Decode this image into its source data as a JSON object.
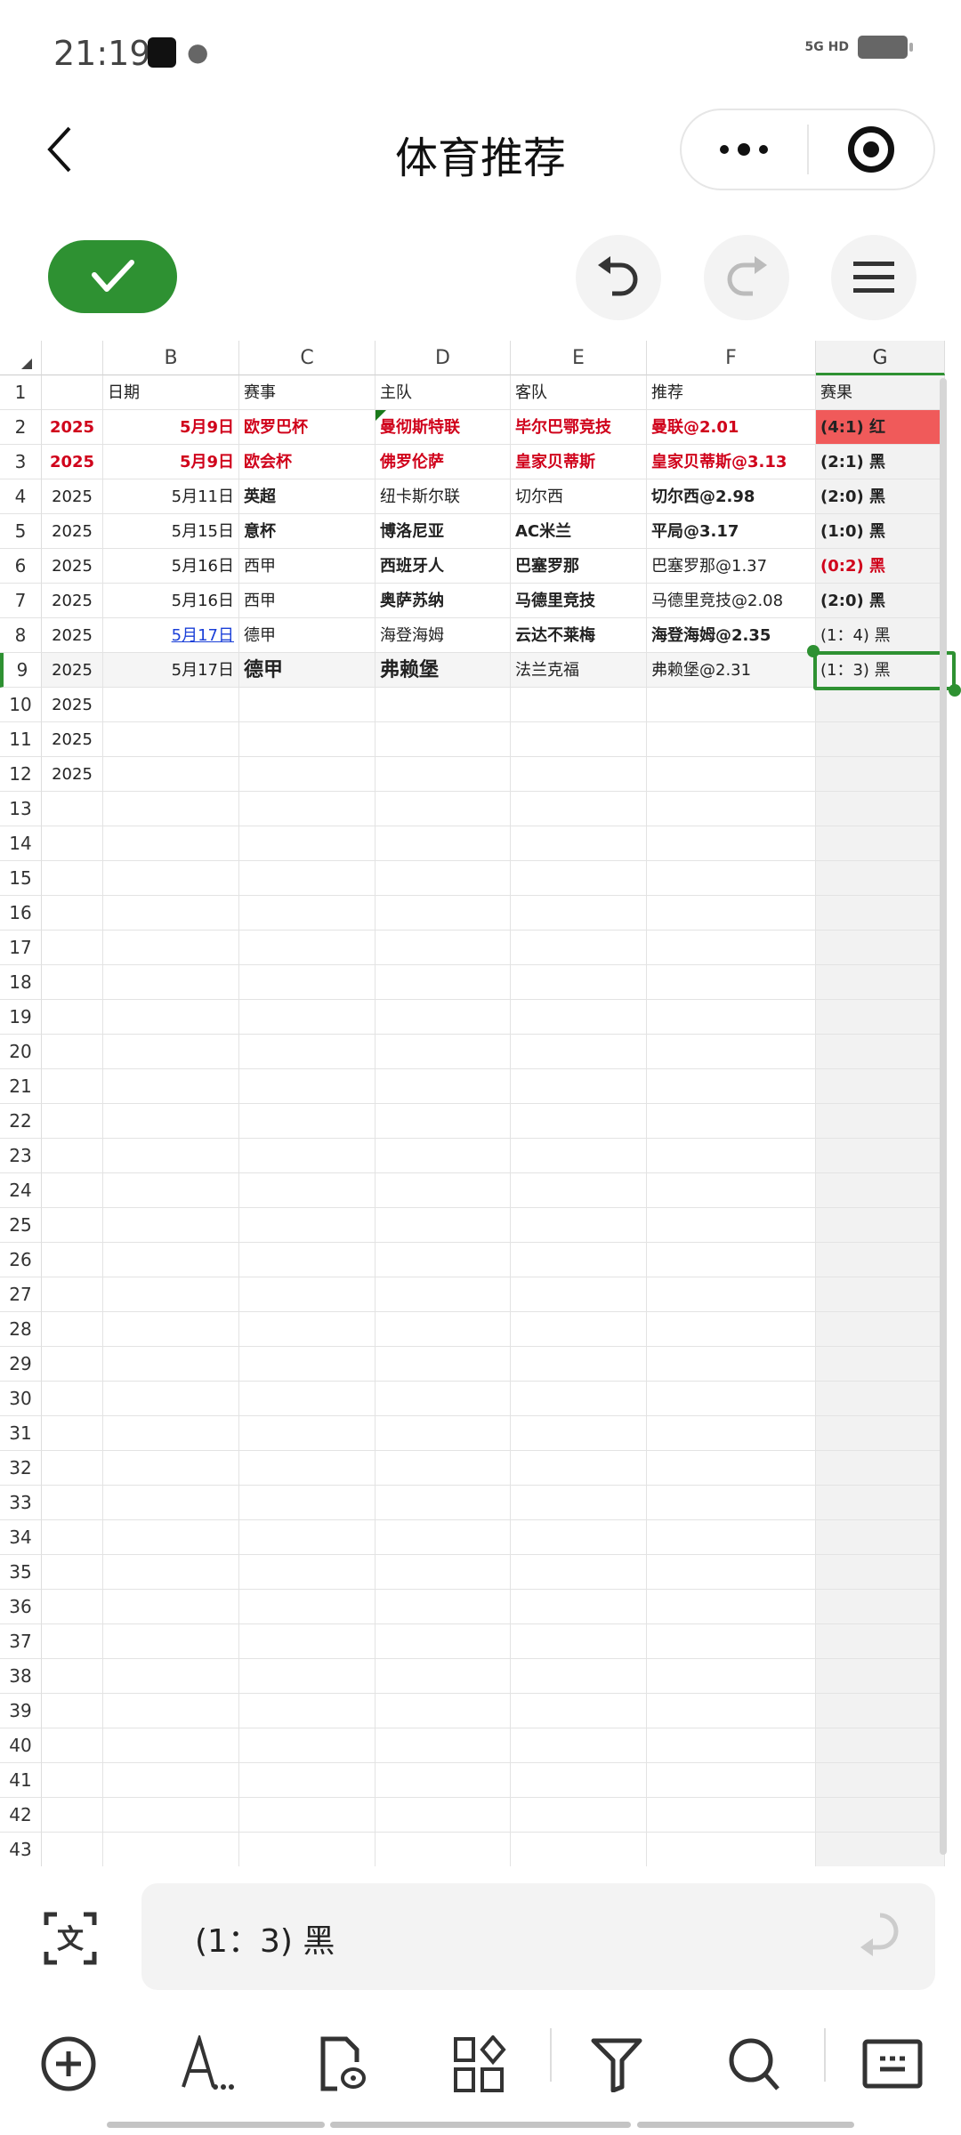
{
  "status_bar": {
    "time": "21:19",
    "network": "5G HD"
  },
  "nav": {
    "title": "体育推荐",
    "back_icon": "chevron-left-icon",
    "more_icon": "more-dots-icon",
    "target_icon": "record-icon"
  },
  "toolbar_top": {
    "confirm_icon": "check-icon",
    "undo_icon": "undo-icon",
    "redo_icon": "redo-icon",
    "menu_icon": "hamburger-icon"
  },
  "colors": {
    "accent_green": "#2e9132",
    "red_text": "#d0021b",
    "red_fill": "#f05a5a",
    "link_blue": "#1a3fd8"
  },
  "sheet": {
    "columns": [
      "",
      "B",
      "C",
      "D",
      "E",
      "F",
      "G"
    ],
    "row_count": 43,
    "selected_cell": "G9",
    "rows": [
      {
        "n": 1,
        "cells": [
          "",
          "日期",
          "赛事",
          "主队",
          "客队",
          "推荐",
          "赛果"
        ],
        "styles": [
          "",
          "",
          "",
          "",
          "",
          "",
          ""
        ]
      },
      {
        "n": 2,
        "cells": [
          "2025",
          "5月9日",
          "欧罗巴杯",
          "曼彻斯特联",
          "毕尔巴鄂竞技",
          "曼联@2.01",
          "(4:1) 红"
        ],
        "styles": [
          "red b",
          "red b right",
          "red b",
          "red b",
          "red b",
          "red b",
          "b redfill"
        ]
      },
      {
        "n": 3,
        "cells": [
          "2025",
          "5月9日",
          "欧会杯",
          "佛罗伦萨",
          "皇家贝蒂斯",
          "皇家贝蒂斯@3.13",
          "(2:1) 黑"
        ],
        "styles": [
          "red b",
          "red b right",
          "red b",
          "red b",
          "red b",
          "red b",
          "b"
        ]
      },
      {
        "n": 4,
        "cells": [
          "2025",
          "5月11日",
          "英超",
          "纽卡斯尔联",
          "切尔西",
          "切尔西@2.98",
          "(2:0) 黑"
        ],
        "styles": [
          "",
          "right",
          "b",
          "",
          "",
          "b",
          "b"
        ]
      },
      {
        "n": 5,
        "cells": [
          "2025",
          "5月15日",
          "意杯",
          "博洛尼亚",
          "AC米兰",
          "平局@3.17",
          "(1:0) 黑"
        ],
        "styles": [
          "",
          "right",
          "b",
          "b",
          "b",
          "b",
          "b"
        ]
      },
      {
        "n": 6,
        "cells": [
          "2025",
          "5月16日",
          "西甲",
          "西班牙人",
          "巴塞罗那",
          "巴塞罗那@1.37",
          "(0:2) 黑"
        ],
        "styles": [
          "",
          "right",
          "",
          "b",
          "b",
          "",
          "red b"
        ]
      },
      {
        "n": 7,
        "cells": [
          "2025",
          "5月16日",
          "西甲",
          "奥萨苏纳",
          "马德里竞技",
          "马德里竞技@2.08",
          "(2:0) 黑"
        ],
        "styles": [
          "",
          "right",
          "",
          "b",
          "b",
          "",
          "b"
        ]
      },
      {
        "n": 8,
        "cells": [
          "2025",
          "5月17日",
          "德甲",
          "海登海姆",
          "云达不莱梅",
          "海登海姆@2.35",
          "(1：4) 黑"
        ],
        "styles": [
          "",
          "right link",
          "",
          "",
          "b",
          "b",
          ""
        ]
      },
      {
        "n": 9,
        "cells": [
          "2025",
          "5月17日",
          "德甲",
          "弗赖堡",
          "法兰克福",
          "弗赖堡@2.31",
          "(1：3) 黑"
        ],
        "styles": [
          "",
          "right",
          "b large",
          "b large",
          "",
          "",
          ""
        ]
      },
      {
        "n": 10,
        "cells": [
          "2025",
          "",
          "",
          "",
          "",
          "",
          ""
        ],
        "styles": [
          "",
          "",
          "",
          "",
          "",
          "",
          ""
        ]
      },
      {
        "n": 11,
        "cells": [
          "2025",
          "",
          "",
          "",
          "",
          "",
          ""
        ],
        "styles": [
          "",
          "",
          "",
          "",
          "",
          "",
          ""
        ]
      },
      {
        "n": 12,
        "cells": [
          "2025",
          "",
          "",
          "",
          "",
          "",
          ""
        ],
        "styles": [
          "",
          "",
          "",
          "",
          "",
          "",
          ""
        ]
      }
    ]
  },
  "formula_bar": {
    "value": "(1：3) 黑",
    "ocr_icon": "text-scan-icon",
    "enter_icon": "enter-icon"
  },
  "bottom_toolbar": [
    "add-circle-icon",
    "font-format-icon",
    "document-preview-icon",
    "apps-icon",
    "filter-icon",
    "search-icon",
    "keyboard-icon"
  ]
}
